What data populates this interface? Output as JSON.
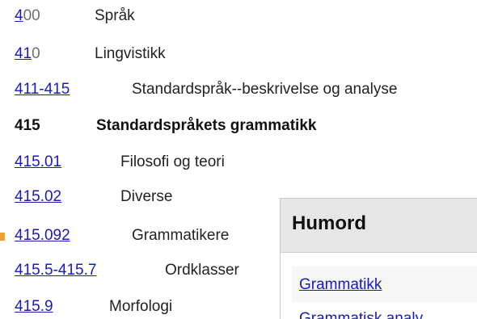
{
  "classification": {
    "rows": [
      {
        "code_link": "4",
        "code_rest": "00",
        "label": "Språk"
      },
      {
        "code_link": "41",
        "code_rest": "0",
        "label": "Lingvistikk"
      },
      {
        "code_link": "411-415",
        "code_rest": "",
        "label": "Standardspråk--beskrivelse og analyse"
      },
      {
        "code": "415",
        "label": "Standardspråkets grammatikk"
      },
      {
        "code_link": "415.01",
        "label": "Filosofi og teori"
      },
      {
        "code_link": "415.02",
        "label": "Diverse"
      },
      {
        "code_link": "415.092",
        "label": "Grammatikere"
      },
      {
        "code_link": "415.5-415.7",
        "label": "Ordklasser"
      },
      {
        "code_link": "415.9",
        "label": "Morfologi"
      }
    ]
  },
  "humord_panel": {
    "title": "Humord",
    "items": [
      "Grammatikk",
      "Grammatisk analy"
    ]
  },
  "colors": {
    "link": "#1a1ab8",
    "text": "#222222",
    "panel_header_bg": "#e6e6e6",
    "marker": "#f0a030"
  }
}
